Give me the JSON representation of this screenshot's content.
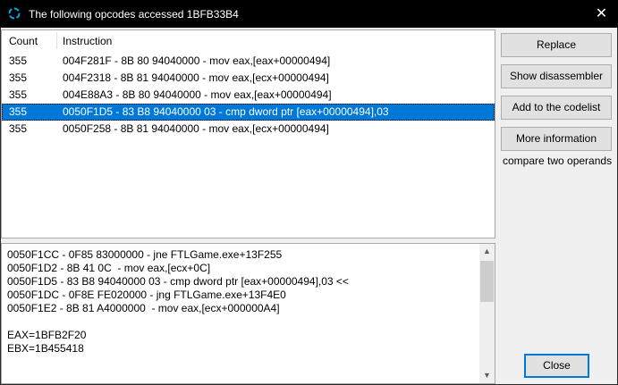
{
  "window": {
    "title": "The following opcodes accessed 1BFB33B4",
    "close_glyph": "✕"
  },
  "list": {
    "columns": {
      "count": "Count",
      "instruction": "Instruction"
    },
    "rows": [
      {
        "count": "355",
        "instruction": "004F281F - 8B 80 94040000  - mov eax,[eax+00000494]"
      },
      {
        "count": "355",
        "instruction": "004F2318 - 8B 81 94040000  - mov eax,[ecx+00000494]"
      },
      {
        "count": "355",
        "instruction": "004E88A3 - 8B 80 94040000  - mov eax,[eax+00000494]"
      },
      {
        "count": "355",
        "instruction": "0050F1D5 - 83 B8 94040000 03 - cmp dword ptr [eax+00000494],03",
        "selected": true
      },
      {
        "count": "355",
        "instruction": "0050F258 - 8B 81 94040000  - mov eax,[ecx+00000494]"
      }
    ]
  },
  "disasm": {
    "lines": [
      "0050F1CC - 0F85 83000000 - jne FTLGame.exe+13F255",
      "0050F1D2 - 8B 41 0C  - mov eax,[ecx+0C]",
      "0050F1D5 - 83 B8 94040000 03 - cmp dword ptr [eax+00000494],03 <<",
      "0050F1DC - 0F8E FE020000 - jng FTLGame.exe+13F4E0",
      "0050F1E2 - 8B 81 A4000000  - mov eax,[ecx+000000A4]",
      "",
      "EAX=1BFB2F20",
      "EBX=1B455418"
    ],
    "scroll_up_glyph": "▲",
    "scroll_down_glyph": "▼"
  },
  "buttons": {
    "replace": "Replace",
    "show_disassembler": "Show disassembler",
    "add_to_codelist": "Add to the codelist",
    "more_information": "More information",
    "close": "Close"
  },
  "hint": "compare two operands",
  "colors": {
    "selection": "#0078d7",
    "titlebar": "#000000",
    "accent": "#00a8e8"
  },
  "icons": {
    "app": "cheat-engine-logo-icon",
    "cursor": "mouse-pointer-icon"
  }
}
